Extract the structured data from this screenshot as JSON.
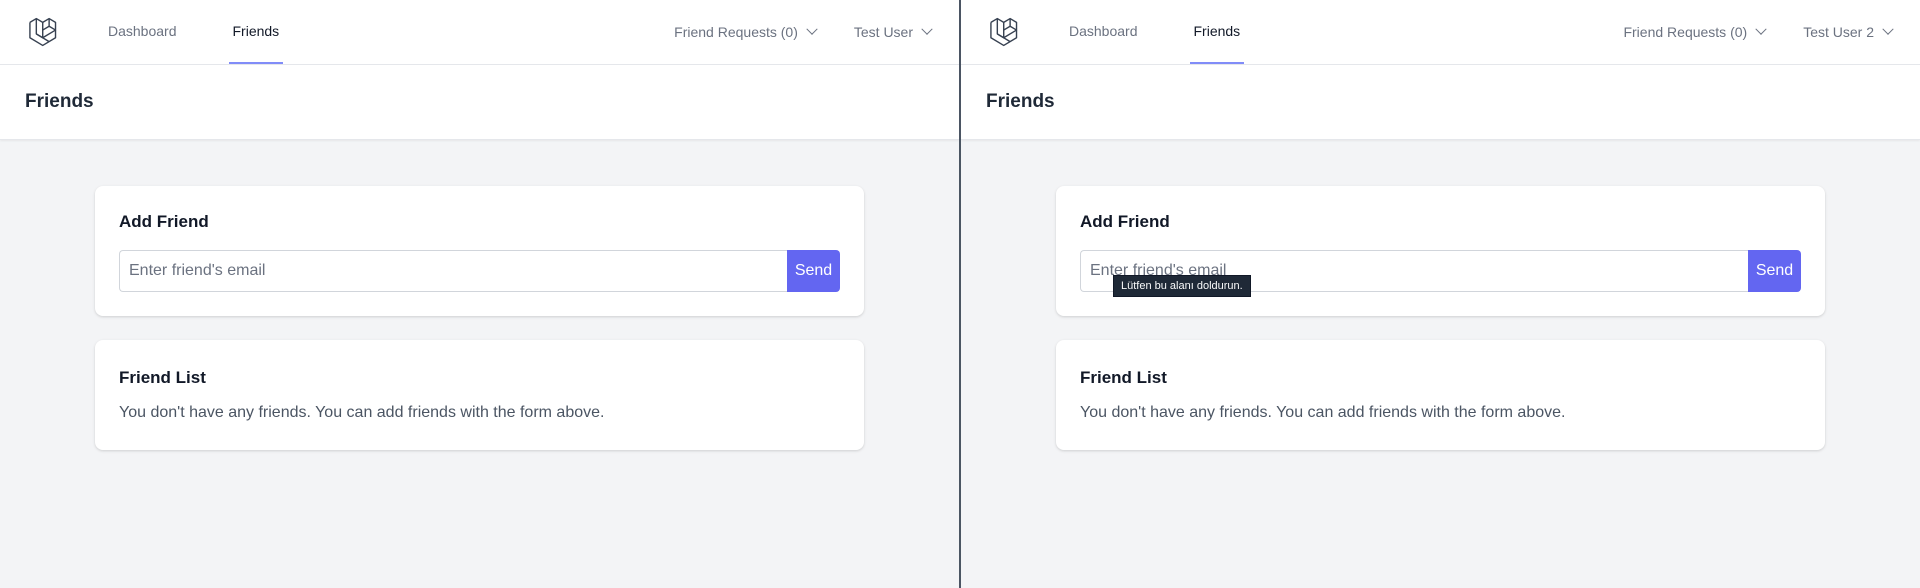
{
  "windows": [
    {
      "nav": {
        "links": [
          {
            "label": "Dashboard"
          },
          {
            "label": "Friends"
          }
        ],
        "friend_requests": "Friend Requests (0)",
        "user": "Test User"
      },
      "header": {
        "title": "Friends"
      },
      "add_friend": {
        "title": "Add Friend",
        "placeholder": "Enter friend's email",
        "value": "",
        "send_label": "Send"
      },
      "friend_list": {
        "title": "Friend List",
        "empty_message": "You don't have any friends. You can add friends with the form above."
      }
    },
    {
      "nav": {
        "links": [
          {
            "label": "Dashboard"
          },
          {
            "label": "Friends"
          }
        ],
        "friend_requests": "Friend Requests (0)",
        "user": "Test User 2"
      },
      "header": {
        "title": "Friends"
      },
      "add_friend": {
        "title": "Add Friend",
        "placeholder": "Enter friend's email",
        "value": "",
        "send_label": "Send",
        "validation_tooltip": "Lütfen bu alanı doldurun."
      },
      "friend_list": {
        "title": "Friend List",
        "empty_message": "You don't have any friends. You can add friends with the form above."
      }
    }
  ],
  "colors": {
    "accent": "#6366f1",
    "active_underline": "#818cf8",
    "page_bg": "#f3f4f6",
    "tooltip_bg": "#1f2937"
  },
  "icons": {
    "logo": "laravel-logo-icon",
    "dropdown": "chevron-down-icon"
  }
}
